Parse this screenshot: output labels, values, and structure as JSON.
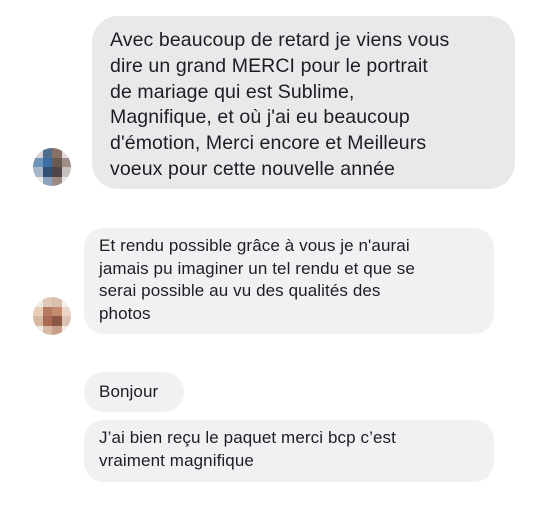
{
  "messages": [
    {
      "text": "Avec beaucoup de retard je viens vous\ndire un grand MERCI pour le portrait\nde mariage qui est Sublime,\nMagnifique, et où j'ai eu beaucoup\nd'émotion, Merci encore et Meilleurs\nvoeux  pour cette nouvelle année"
    },
    {
      "text": "Et rendu possible grâce à vous je n'aurai\njamais pu imaginer un tel rendu et que se\nserai possible au vu des qualités des\nphotos"
    },
    {
      "text": "Bonjour"
    },
    {
      "text": "J’ai bien reçu le paquet merci bcp c’est\nvraiment magnifique"
    }
  ],
  "avatars": [
    {
      "icon": "blurred-profile-photo",
      "colors": [
        [
          "#d8d4d8",
          "#4f6d8c",
          "#8a6f66",
          "#e0dcdc"
        ],
        [
          "#6f94bb",
          "#3b6ea2",
          "#6b5a52",
          "#9d8f88"
        ],
        [
          "#a7b6c8",
          "#2f4f73",
          "#4e4548",
          "#c8c0bc"
        ],
        [
          "#eaeaea",
          "#8aa2bd",
          "#9c8a82",
          "#ebe8e6"
        ]
      ]
    },
    {
      "icon": "blurred-profile-photo",
      "colors": [
        [
          "#f2ece6",
          "#e0c7b6",
          "#d9bfae",
          "#f4efea"
        ],
        [
          "#e8cdb8",
          "#b57b61",
          "#c48b70",
          "#ead5c8"
        ],
        [
          "#d9b8a2",
          "#a86a53",
          "#8c5846",
          "#dcc2b4"
        ],
        [
          "#f1e9e3",
          "#d8b9a6",
          "#c79f8c",
          "#f3ece7"
        ]
      ]
    }
  ]
}
